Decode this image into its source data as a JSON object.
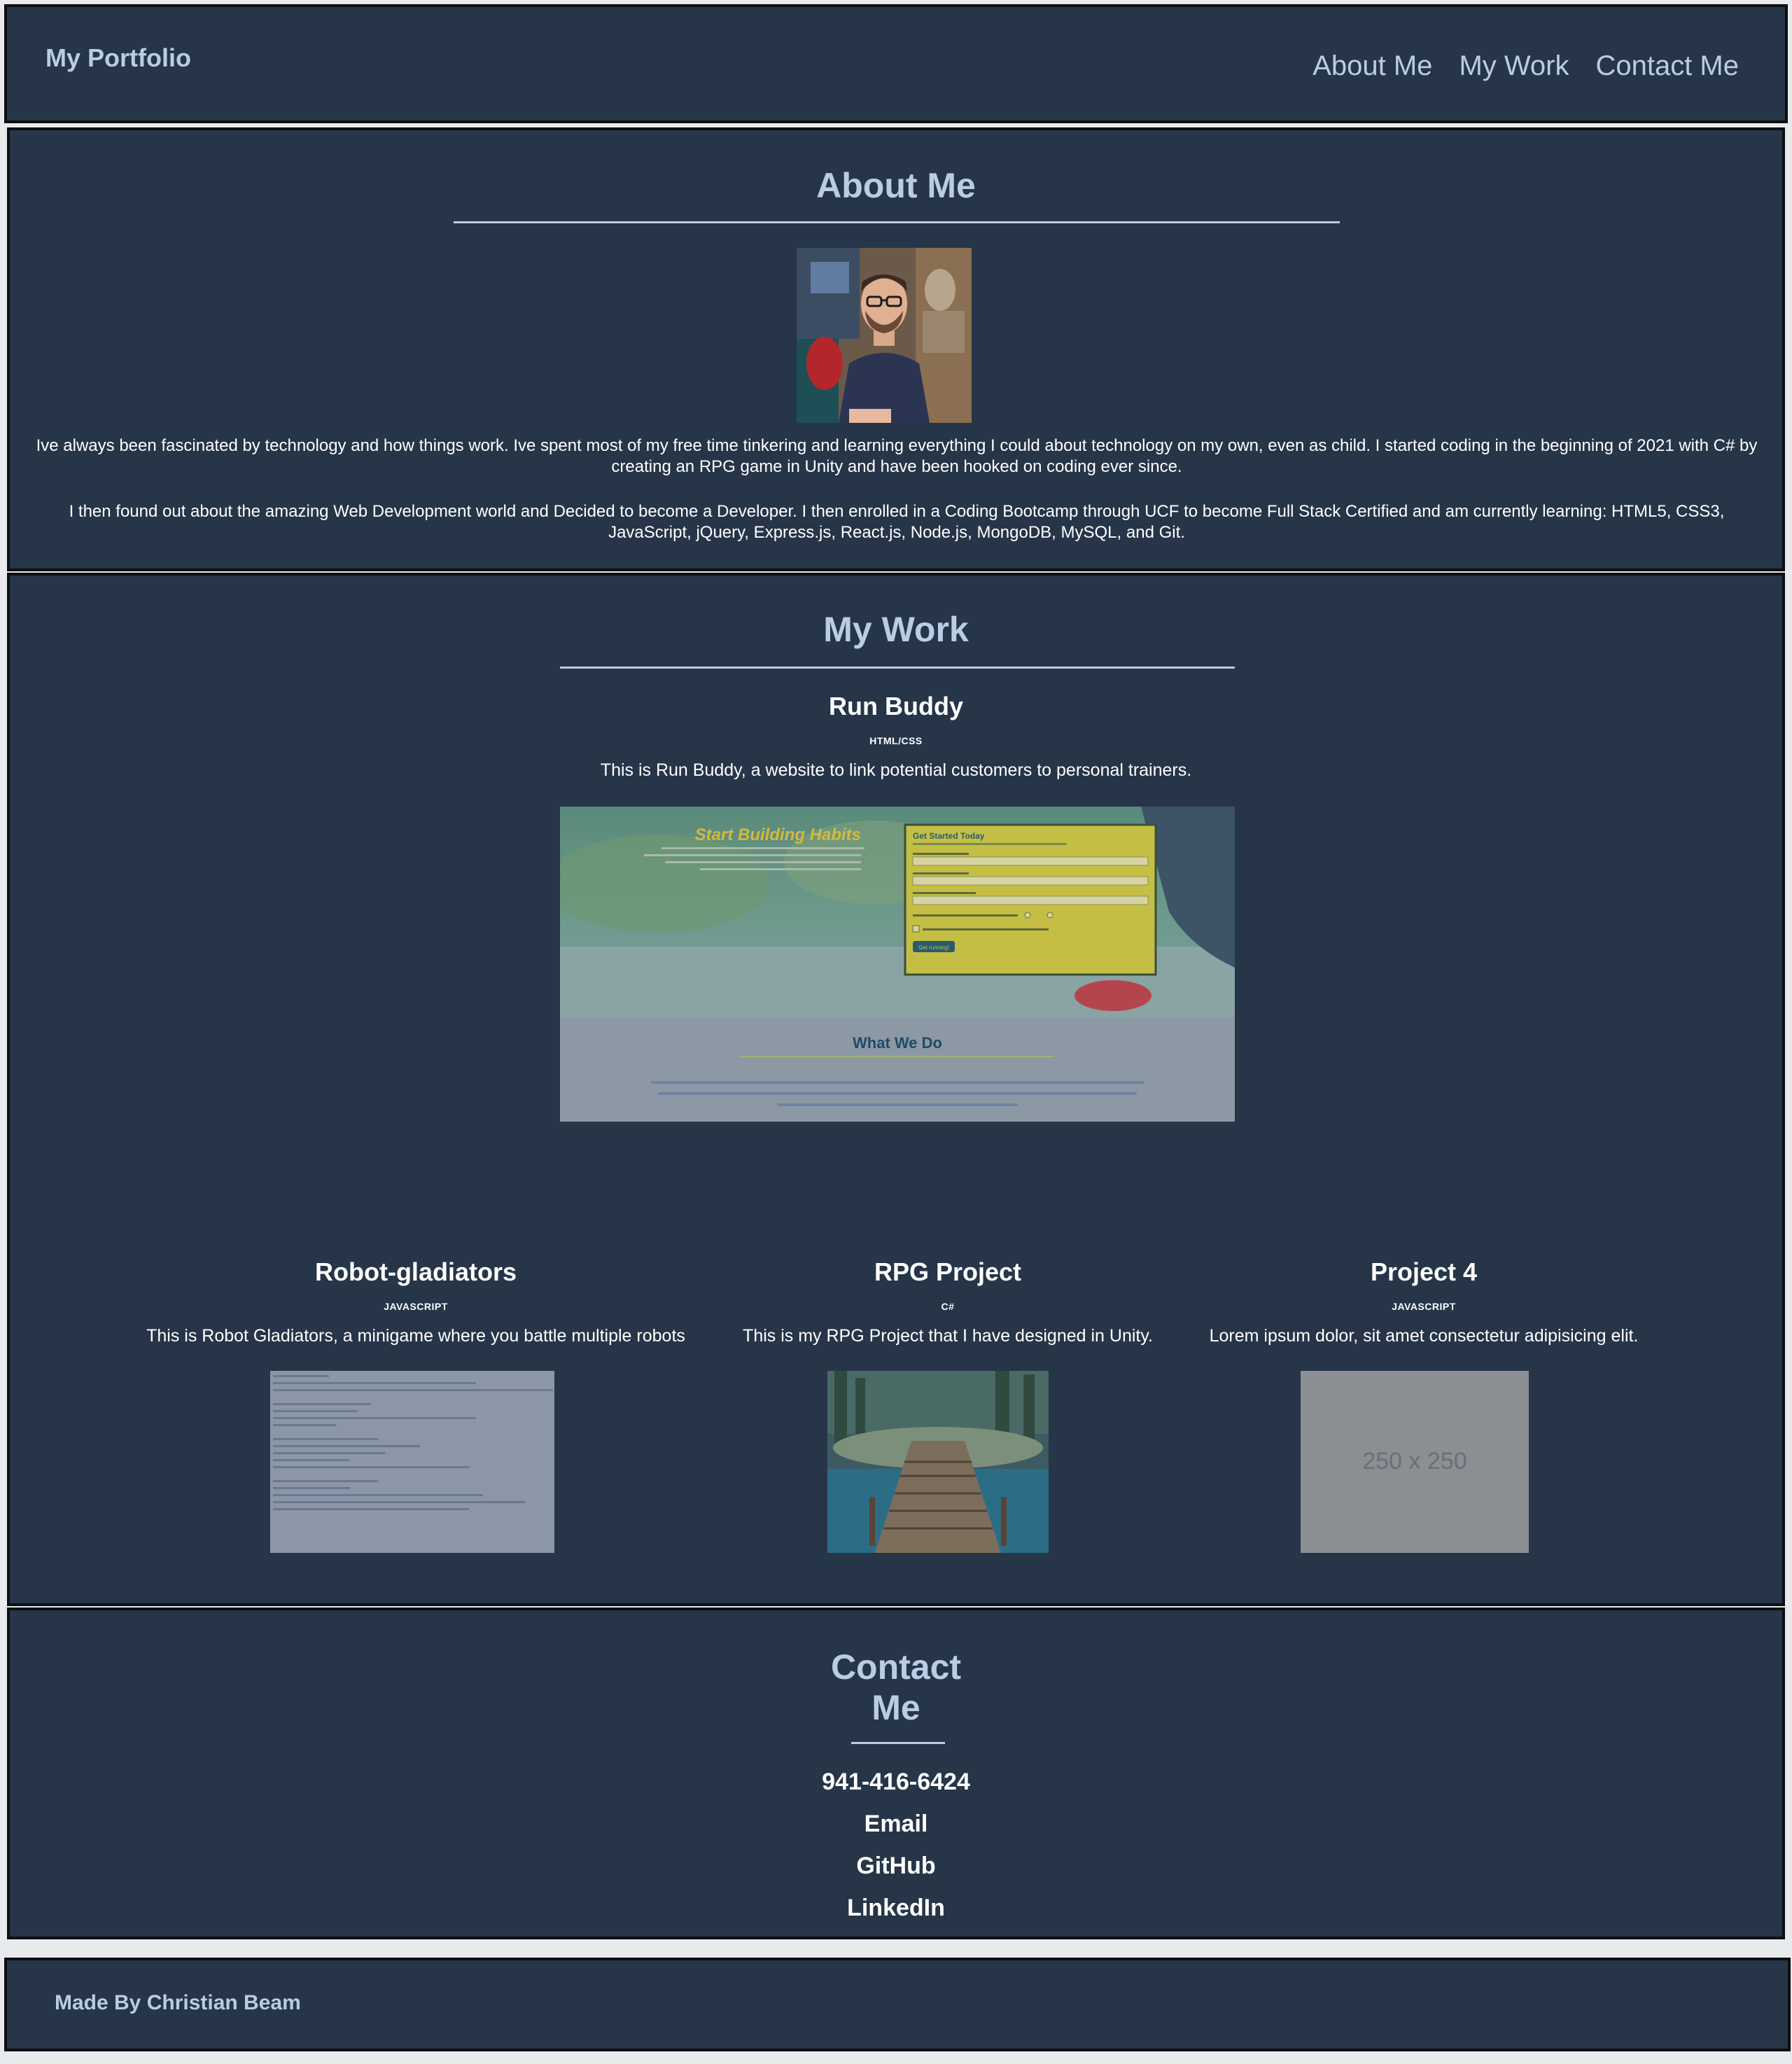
{
  "header": {
    "brand": "My Portfolio",
    "nav": [
      "About Me",
      "My Work",
      "Contact Me"
    ]
  },
  "about": {
    "title": "About Me",
    "paragraph1": "Ive always been fascinated by technology and how things work. Ive spent most of my free time tinkering and learning everything I could about technology on my own, even as child. I started coding in the beginning of 2021 with C# by creating an RPG game in Unity and have been hooked on coding ever since.",
    "paragraph2": "I then found out about the amazing Web Development world and Decided to become a Developer. I then enrolled in a Coding Bootcamp through UCF to become Full Stack Certified and am currently learning: HTML5, CSS3, JavaScript, jQuery, Express.js, React.js, Node.js, MongoDB, MySQL, and Git."
  },
  "work": {
    "title": "My Work",
    "featured": {
      "title": "Run Buddy",
      "tag": "HTML/CSS",
      "description": "This is Run Buddy, a website to link potential customers to personal trainers.",
      "screenshot": {
        "hero_heading": "Start Building Habits",
        "form_heading": "Get Started Today",
        "form_button": "Get running!",
        "section_heading": "What We Do"
      }
    },
    "projects": [
      {
        "title": "Robot-gladiators",
        "tag": "JAVASCRIPT",
        "description": "This is Robot Gladiators, a minigame where you battle multiple robots"
      },
      {
        "title": "RPG Project",
        "tag": "C#",
        "description": "This is my RPG Project that I have designed in Unity."
      },
      {
        "title": "Project 4",
        "tag": "JAVASCRIPT",
        "description": "Lorem ipsum dolor, sit amet consectetur adipisicing elit.",
        "placeholder": "250 x 250"
      }
    ]
  },
  "contact": {
    "title_line1": "Contact",
    "title_line2": "Me",
    "phone": "941-416-6424",
    "links": [
      "Email",
      "GitHub",
      "LinkedIn"
    ]
  },
  "footer": {
    "text": "Made By Christian Beam"
  },
  "colors": {
    "panel": "#263548",
    "accent": "#b9cde4",
    "page": "#e9eaec"
  }
}
